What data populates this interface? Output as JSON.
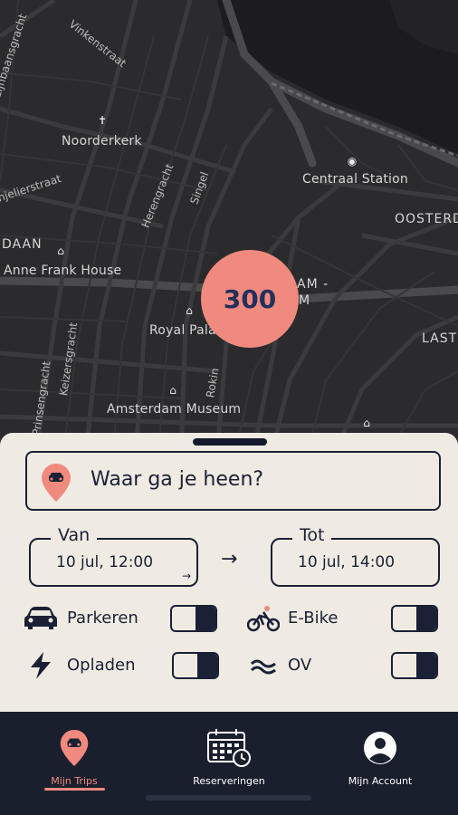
{
  "map": {
    "cluster_count": "300",
    "places": [
      "Noorderkerk",
      "Centraal Station",
      "Anne Frank House",
      "Royal Pala",
      "Amsterdam Museum",
      "OOSTERD",
      "DAAN",
      "LAST",
      "AM -",
      "M"
    ],
    "streets": [
      "Vinkenstraat",
      "Lijnbaansgracht",
      "njelierstraat",
      "Herengracht",
      "Singel",
      "Prinsengracht",
      "Keizersgracht",
      "Rokin"
    ]
  },
  "search": {
    "placeholder": "Waar ga je heen?"
  },
  "van": {
    "label": "Van",
    "value": "10 jul, 12:00"
  },
  "tot": {
    "label": "Tot",
    "value": "10 jul, 14:00"
  },
  "options": {
    "parkeren": "Parkeren",
    "ebike": "E-Bike",
    "opladen": "Opladen",
    "ov": "OV"
  },
  "nav": {
    "trips": "Mijn Trips",
    "reserveringen": "Reserveringen",
    "account": "Mijn Account"
  },
  "colors": {
    "accent": "#f08a7e",
    "navy": "#1a2035",
    "sheet": "#efebe3",
    "map": "#2b2b2d"
  }
}
